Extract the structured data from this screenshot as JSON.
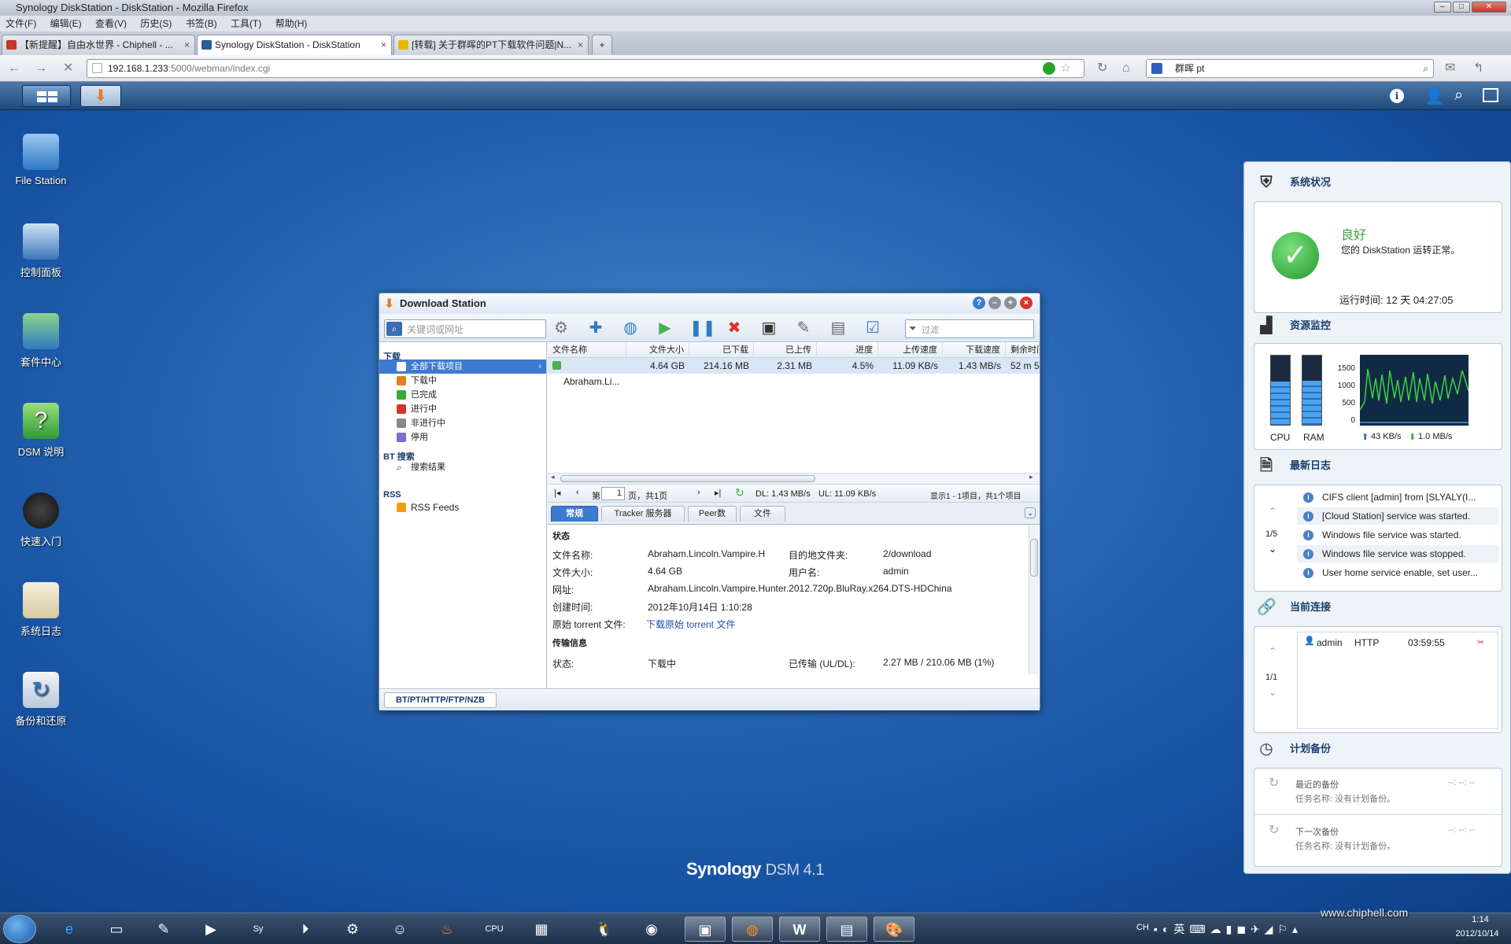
{
  "browser": {
    "title": "Synology DiskStation - DiskStation - Mozilla Firefox",
    "menu": [
      "文件(F)",
      "编辑(E)",
      "查看(V)",
      "历史(S)",
      "书签(B)",
      "工具(T)",
      "帮助(H)"
    ],
    "tabs": [
      {
        "label": "【新提醒】自由水世界 - Chiphell - ..."
      },
      {
        "label": "Synology DiskStation - DiskStation"
      },
      {
        "label": "[转载] 关于群晖的PT下载软件问题|N..."
      }
    ],
    "new_tab": "+",
    "url_host": "192.168.1.233",
    "url_rest": ":5000/webman/index.cgi",
    "search_value": "群晖 pt"
  },
  "desktop": {
    "icons": [
      {
        "label": "File Station"
      },
      {
        "label": "控制面板"
      },
      {
        "label": "套件中心"
      },
      {
        "label": "DSM 说明"
      },
      {
        "label": "快速入门"
      },
      {
        "label": "系统日志"
      },
      {
        "label": "备份和还原"
      }
    ],
    "brand": "Synology",
    "brand_version": "DSM 4.1"
  },
  "ds": {
    "title": "Download Station",
    "search_placeholder": "关键词或网址",
    "filter_placeholder": "过滤",
    "sections": {
      "download": "下载",
      "bt": "BT 搜索",
      "rss": "RSS"
    },
    "nav": [
      "全部下载项目",
      "下载中",
      "已完成",
      "进行中",
      "非进行中",
      "停用"
    ],
    "bt_item": "搜索结果",
    "rss_item": "RSS Feeds",
    "columns": [
      "文件名称",
      "文件大小",
      "已下载",
      "已上传",
      "进度",
      "上传速度",
      "下载速度",
      "剩余时间"
    ],
    "row": [
      "Abraham.Li...",
      "4.64 GB",
      "214.16 MB",
      "2.31 MB",
      "4.5%",
      "11.09 KB/s",
      "1.43 MB/s",
      "52 m 5"
    ],
    "pager": {
      "page_prefix": "第",
      "page": "1",
      "page_suffix": "页，共1页",
      "dl": "DL: 1.43 MB/s",
      "ul": "UL: 11.09 KB/s",
      "summary": "显示1 - 1项目，共1个项目"
    },
    "tabs": [
      "常规",
      "Tracker 服务器",
      "Peer数",
      "文件"
    ],
    "status_header": "状态",
    "details": {
      "name_label": "文件名称:",
      "name": "Abraham.Lincoln.Vampire.H",
      "dest_label": "目的地文件夹:",
      "dest": "2/download",
      "size_label": "文件大小:",
      "size": "4.64 GB",
      "user_label": "用户名:",
      "user": "admin",
      "url_label": "网址:",
      "url": "Abraham.Lincoln.Vampire.Hunter.2012.720p.BluRay.x264.DTS-HDChina",
      "created_label": "创建时间:",
      "created": "2012年10月14日 1:10:28",
      "torrent_label": "原始 torrent 文件:",
      "torrent": "下载原始 torrent 文件"
    },
    "transfer_header": "传输信息",
    "transfer": {
      "status_label": "状态:",
      "status": "下载中",
      "transferred_label": "已传输 (UL/DL):",
      "transferred": "2.27 MB / 210.06 MB (1%)"
    },
    "footer_tab": "BT/PT/HTTP/FTP/NZB"
  },
  "panel": {
    "health": {
      "title": "系统状况",
      "status": "良好",
      "desc": "您的 DiskStation 运转正常。",
      "uptime": "运行时间: 12 天 04:27:05"
    },
    "monitor": {
      "title": "资源监控",
      "cpu": "CPU",
      "ram": "RAM",
      "cpu_level": 0.62,
      "ram_level": 0.64,
      "yticks": [
        "1500",
        "1000",
        "500",
        "0"
      ],
      "up": "43 KB/s",
      "down": "1.0 MB/s"
    },
    "logs": {
      "title": "最新日志",
      "page": "1/5",
      "items": [
        "CIFS client [admin] from [SLYALY(I...",
        "[Cloud Station] service was started.",
        "Windows file service was started.",
        "Windows file service was stopped.",
        "User home service enable, set user..."
      ]
    },
    "connections": {
      "title": "当前连接",
      "page": "1/1",
      "user": "admin",
      "proto": "HTTP",
      "time": "03:59:55"
    },
    "backup": {
      "title": "计划备份",
      "last_label": "最近的备份",
      "last_task": "任务名称: 没有计划备份。",
      "next_label": "下一次备份",
      "next_task": "任务名称: 没有计划备份。",
      "placeholder": "--: --: --"
    }
  },
  "taskbar": {
    "lang": "CH",
    "time": "1:14",
    "date": "2012/10/14"
  },
  "watermark": "www.chiphell.com"
}
